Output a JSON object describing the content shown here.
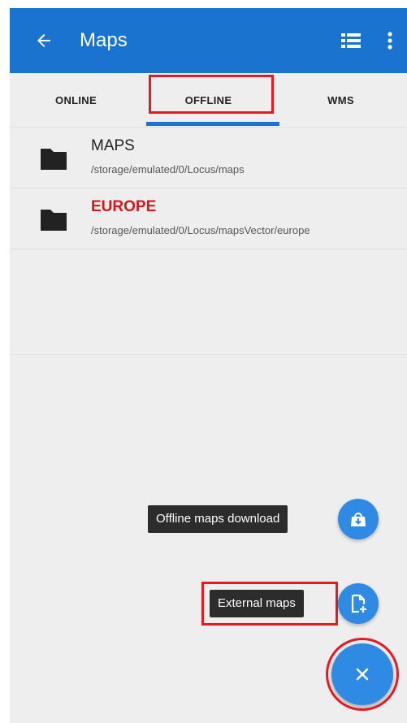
{
  "appbar": {
    "title": "Maps",
    "background": "#1a73cf",
    "back_icon": "arrow-left-icon",
    "list_icon": "list-view-icon",
    "more_icon": "more-vertical-icon"
  },
  "tabs": [
    {
      "label": "ONLINE",
      "selected": false
    },
    {
      "label": "OFFLINE",
      "selected": true
    },
    {
      "label": "WMS",
      "selected": false
    }
  ],
  "folders": [
    {
      "name": "MAPS",
      "path": "/storage/emulated/0/Locus/maps",
      "highlighted": false
    },
    {
      "name": "EUROPE",
      "path": "/storage/emulated/0/Locus/mapsVector/europe",
      "highlighted": true
    }
  ],
  "fab_menu": {
    "download_label": "Offline maps download",
    "download_icon": "download-map-icon",
    "external_label": "External maps",
    "external_icon": "add-file-icon",
    "close_icon": "close-icon"
  },
  "colors": {
    "accent": "#1a73cf",
    "fab": "#2f8ae3",
    "highlight": "#e31b23",
    "tooltip": "#2c2c2c"
  }
}
